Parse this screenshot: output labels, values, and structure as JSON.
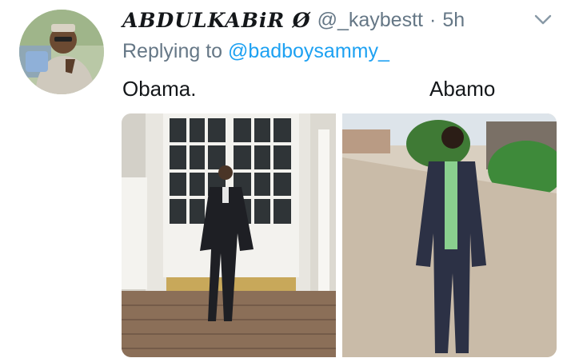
{
  "tweet": {
    "display_name": "ABDULKABiR Ø",
    "handle": "@_kaybestt",
    "separator": "·",
    "time": "5h",
    "reply_prefix": "Replying to ",
    "reply_mention": "@badboysammy_",
    "caption_left": "Obama.",
    "caption_right": "Abamo"
  },
  "icons": {
    "more": "chevron-down-icon"
  },
  "colors": {
    "text": "#14171a",
    "muted": "#657786",
    "link": "#1da1f2"
  }
}
